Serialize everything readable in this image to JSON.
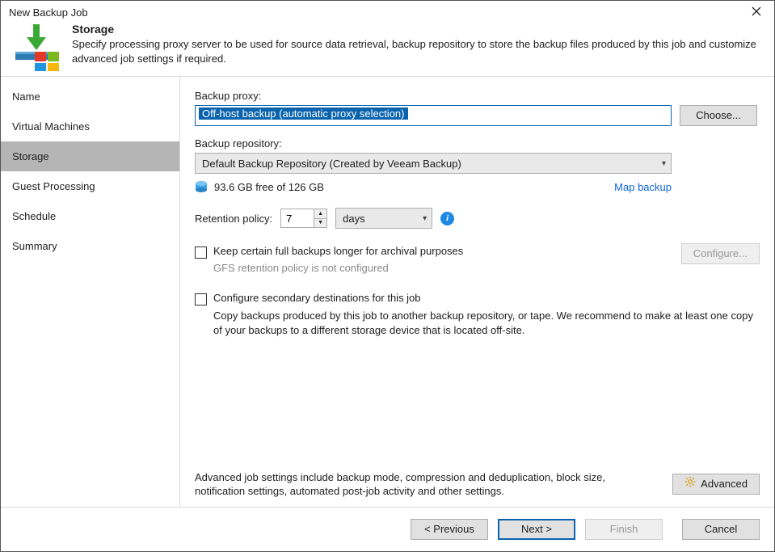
{
  "window": {
    "title": "New Backup Job"
  },
  "header": {
    "title": "Storage",
    "description": "Specify processing proxy server to be used for source data retrieval, backup repository to store the backup files produced by this job and customize advanced job settings if required."
  },
  "sidebar": {
    "items": [
      {
        "label": "Name"
      },
      {
        "label": "Virtual Machines"
      },
      {
        "label": "Storage",
        "active": true
      },
      {
        "label": "Guest Processing"
      },
      {
        "label": "Schedule"
      },
      {
        "label": "Summary"
      }
    ]
  },
  "main": {
    "proxy_label": "Backup proxy:",
    "proxy_value": "Off-host backup (automatic proxy selection)",
    "choose_label": "Choose...",
    "repo_label": "Backup repository:",
    "repo_value": "Default Backup Repository (Created by Veeam Backup)",
    "repo_free": "93.6 GB free of 126 GB",
    "map_backup": "Map backup",
    "retention_label": "Retention policy:",
    "retention_value": "7",
    "retention_unit": "days",
    "gfs_checkbox": "Keep certain full backups longer for archival purposes",
    "gfs_sub": "GFS retention policy is not configured",
    "configure_label": "Configure...",
    "secondary_checkbox": "Configure secondary destinations for this job",
    "secondary_desc": "Copy backups produced by this job to another backup repository, or tape. We recommend to make at least one copy of your backups to a different storage device that is located off-site.",
    "advanced_desc": "Advanced job settings include backup mode, compression and deduplication, block size, notification settings, automated post-job activity and other settings.",
    "advanced_label": "Advanced"
  },
  "footer": {
    "previous": "< Previous",
    "next": "Next >",
    "finish": "Finish",
    "cancel": "Cancel"
  }
}
